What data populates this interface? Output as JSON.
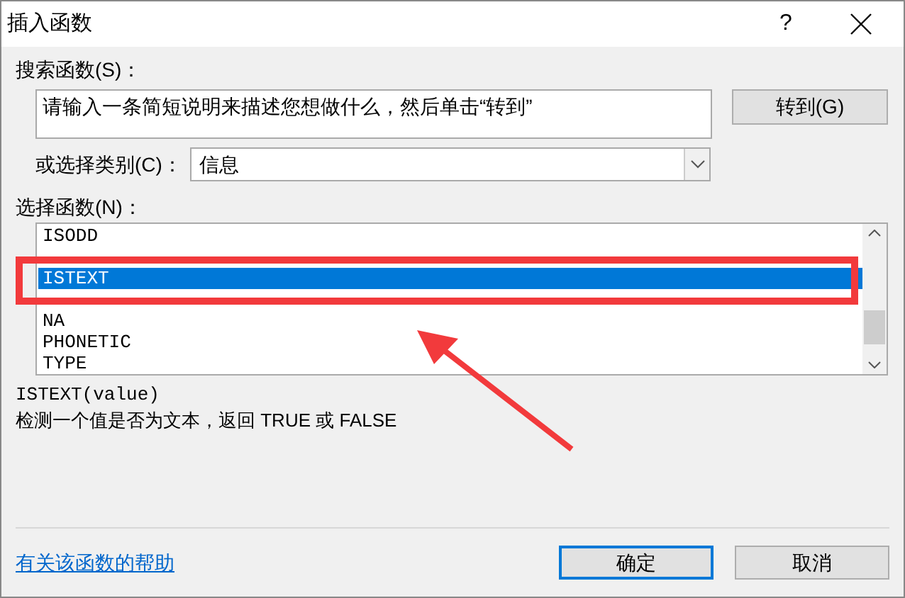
{
  "window": {
    "title": "插入函数",
    "help_glyph": "?"
  },
  "search": {
    "label": "搜索函数(S)：",
    "placeholder": "请输入一条简短说明来描述您想做什么，然后单击“转到”",
    "go_button": "转到(G)"
  },
  "category": {
    "label": "或选择类别(C)：",
    "value": "信息"
  },
  "functions": {
    "label": "选择函数(N)：",
    "items": [
      {
        "kind": "text",
        "name": "ISODD",
        "selected": false
      },
      {
        "kind": "covered",
        "selected": false
      },
      {
        "kind": "text",
        "name": "ISTEXT",
        "selected": true
      },
      {
        "kind": "covered",
        "selected": false
      },
      {
        "kind": "text",
        "name": "NA",
        "selected": false
      },
      {
        "kind": "text",
        "name": "PHONETIC",
        "selected": false
      },
      {
        "kind": "text",
        "name": "TYPE",
        "selected": false
      }
    ]
  },
  "description": {
    "signature": "ISTEXT(value)",
    "text": "检测一个值是否为文本，返回 TRUE 或 FALSE"
  },
  "help_link": "有关该函数的帮助",
  "buttons": [
    {
      "label": "确定",
      "default": true
    },
    {
      "label": "取消",
      "default": false
    }
  ]
}
